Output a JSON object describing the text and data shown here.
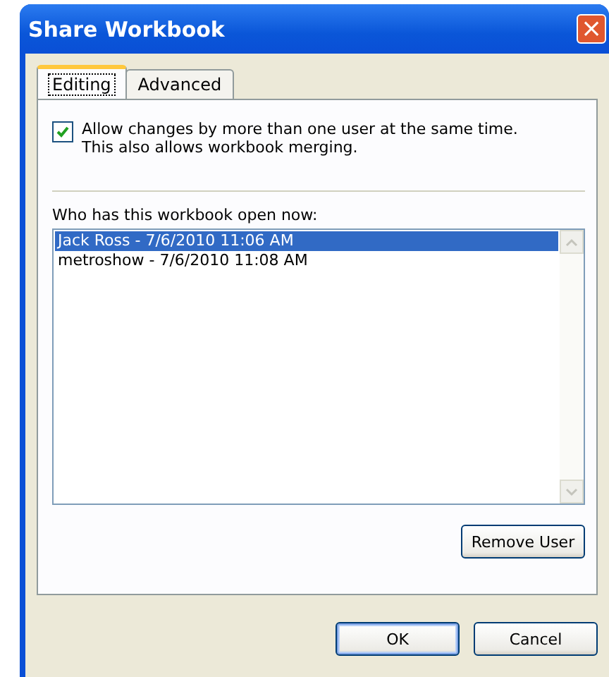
{
  "window": {
    "title": "Share Workbook",
    "close": "×"
  },
  "tabs": [
    {
      "label": "Editing",
      "selected": true
    },
    {
      "label": "Advanced",
      "selected": false
    }
  ],
  "allow_changes": {
    "label": "Allow changes by more than one user at the same time.\nThis also allows workbook merging.",
    "checked": true
  },
  "users_label": "Who has this workbook open now:",
  "users": [
    {
      "label": "Jack Ross - 7/6/2010 11:06 AM",
      "selected": true
    },
    {
      "label": "metroshow - 7/6/2010 11:08 AM",
      "selected": false
    }
  ],
  "remove_button": "Remove User",
  "buttons": [
    "OK",
    "Cancel"
  ]
}
